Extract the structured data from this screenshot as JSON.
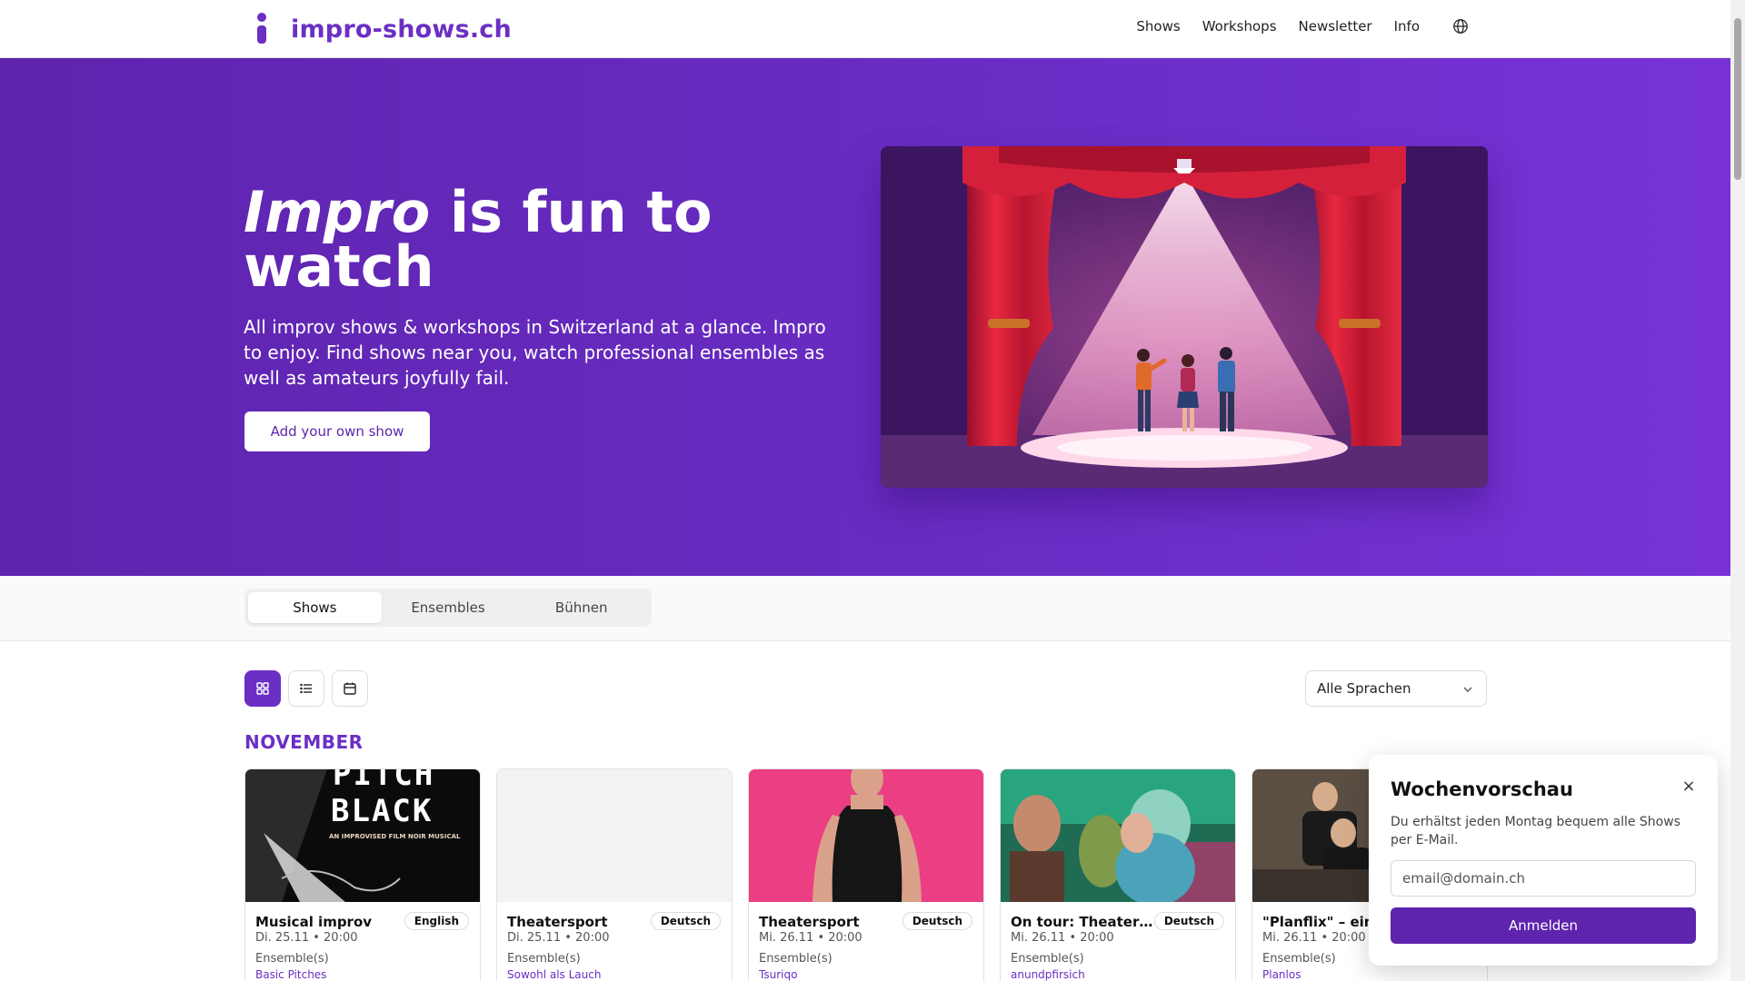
{
  "header": {
    "logo_text": "impro-shows.ch",
    "nav": [
      "Shows",
      "Workshops",
      "Newsletter",
      "Info"
    ],
    "globe_icon": "globe-icon"
  },
  "hero": {
    "title_em": "Impro",
    "title_rest": " is fun to watch",
    "subtitle": "All improv shows & workshops in Switzerland at a glance. Impro to enjoy. Find shows near you, watch professional ensembles as well as amateurs joyfully fail.",
    "cta": "Add your own show"
  },
  "tabs": [
    "Shows",
    "Ensembles",
    "Bühnen"
  ],
  "filter": {
    "language": "Alle Sprachen"
  },
  "month": "NOVEMBER",
  "cards": [
    {
      "title": "Musical improv",
      "badge": "English",
      "date": "Di. 25.11 • 20:00",
      "ensemble_label": "Ensemble(s)",
      "ensemble": "Basic Pitches",
      "poster_line1": "PITCH",
      "poster_line2": "BLACK",
      "poster_line3": "AN IMPROVISED FILM NOIR MUSICAL"
    },
    {
      "title": "Theatersport",
      "badge": "Deutsch",
      "date": "Di. 25.11 • 20:00",
      "ensemble_label": "Ensemble(s)",
      "ensemble": "Sowohl als Lauch"
    },
    {
      "title": "Theatersport",
      "badge": "Deutsch",
      "date": "Mi. 26.11 • 20:00",
      "ensemble_label": "Ensemble(s)",
      "ensemble": "Tsuriqo"
    },
    {
      "title": "On tour: Theatersport",
      "badge": "Deutsch",
      "date": "Mi. 26.11 • 20:00",
      "ensemble_label": "Ensemble(s)",
      "ensemble": "anundpfirsich"
    },
    {
      "title": "\"Planflix\" – eine Impro-Serie",
      "badge": "",
      "date": "Mi. 26.11 • 20:00",
      "ensemble_label": "Ensemble(s)",
      "ensemble": "Planlos"
    }
  ],
  "newsletter": {
    "title": "Wochenvorschau",
    "text": "Du erhältst jeden Montag bequem alle Shows per E-Mail.",
    "placeholder": "email@domain.ch",
    "button": "Anmelden",
    "close": "×"
  },
  "colors": {
    "brand": "#6b2fc4",
    "hero_bg": "#6a2dc6",
    "button_dark": "#5e24ad"
  }
}
